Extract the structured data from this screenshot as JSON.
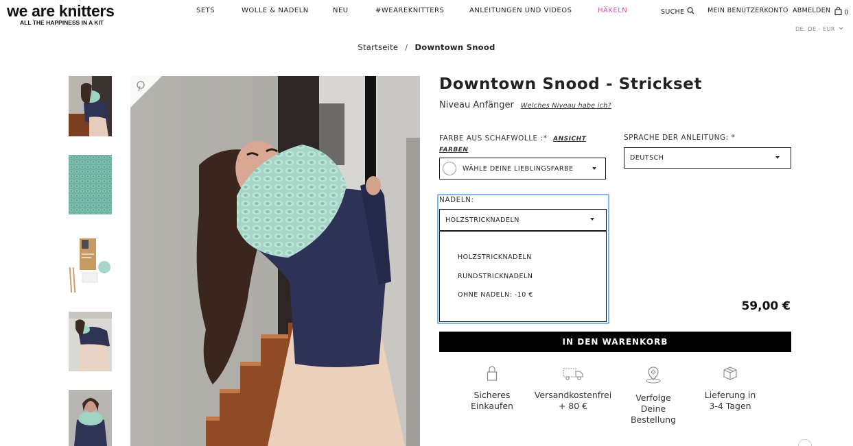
{
  "logo": {
    "name": "we are knitters",
    "tagline": "ALL THE HAPPINESS IN A KIT"
  },
  "nav": [
    {
      "label": "SETS"
    },
    {
      "label": "WOLLE & NADELN"
    },
    {
      "label": "NEU"
    },
    {
      "label": "#WEAREKNITTERS"
    },
    {
      "label": "ANLEITUNGEN UND VIDEOS"
    },
    {
      "label": "HÄKELN",
      "color": "#e34eac"
    }
  ],
  "utility": {
    "search": "SUCHE",
    "account": "MEIN BENUTZERKONTO",
    "logout": "ABMELDEN",
    "cart_count": "0"
  },
  "locale": "DE. DE - EUR",
  "breadcrumb": {
    "home": "Startseite",
    "separator": "/",
    "current": "Downtown Snood"
  },
  "product": {
    "title": "Downtown Snood - Strickset",
    "level": "Niveau Anfänger",
    "level_link": "Welches Niveau habe ich?",
    "color": {
      "label": "FARBE AUS SCHAFWOLLE :*",
      "link_line1": "ANSICHT",
      "link_line2": "FARBEN",
      "placeholder": "WÄHLE DEINE LIEBLINGSFARBE"
    },
    "language": {
      "label": "SPRACHE DER ANLEITUNG: *",
      "value": "DEUTSCH"
    },
    "needles": {
      "label": "NADELN:",
      "value": "HOLZSTRICKNADELN",
      "options": [
        "HOLZSTRICKNADELN",
        "RUNDSTRICKNADELN",
        "OHNE NADELN: -10 €"
      ]
    },
    "price": "59,00 €",
    "add_to_cart": "IN DEN WARENKORB"
  },
  "features": [
    {
      "icon": "lock-icon",
      "line1": "Sicheres",
      "line2": "Einkaufen"
    },
    {
      "icon": "truck-icon",
      "line1": "Versandkostenfrei",
      "line2": "+ 80 €"
    },
    {
      "icon": "location-pin-icon",
      "line1": "Verfolge",
      "line2": "Deine",
      "line3": "Bestellung"
    },
    {
      "icon": "box-icon",
      "line1": "Lieferung in",
      "line2": "3-4 Tagen"
    }
  ]
}
